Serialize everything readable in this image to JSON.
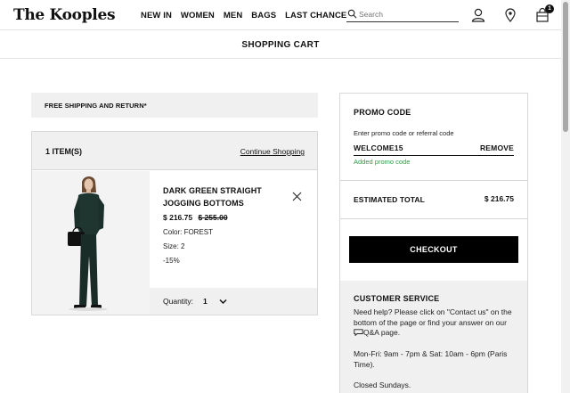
{
  "header": {
    "logo": "The Kooples",
    "nav": [
      "NEW IN",
      "WOMEN",
      "MEN",
      "BAGS",
      "LAST CHANCE"
    ],
    "search_placeholder": "Search",
    "cart_count": "1"
  },
  "page": {
    "title": "SHOPPING CART"
  },
  "shipping_banner": "FREE SHIPPING AND RETURN*",
  "cart": {
    "items_count": "1 ITEM(S)",
    "continue_shopping": "Continue Shopping",
    "item": {
      "name": "DARK GREEN STRAIGHT JOGGING BOTTOMS",
      "price": "$ 216.75",
      "original_price": "$ 255.00",
      "color": "Color: FOREST",
      "size": "Size: 2",
      "discount": "-15%",
      "quantity_label": "Quantity:",
      "quantity": "1"
    }
  },
  "promo": {
    "title": "PROMO CODE",
    "field_label": "Enter promo code or referral code",
    "code": "WELCOME15",
    "remove": "REMOVE",
    "status": "Added promo code"
  },
  "summary": {
    "estimated_label": "ESTIMATED TOTAL",
    "estimated_value": "$ 216.75",
    "checkout": "CHECKOUT"
  },
  "customer_service": {
    "title": "CUSTOMER SERVICE",
    "text_before_icon": "Need help? Please click on \"Contact us\" on the bottom of the page or find your answer on our ",
    "text_after_icon": "Q&A page.",
    "hours": "Mon-Fri: 9am - 7pm & Sat: 10am - 6pm (Paris Time).",
    "closed": "Closed Sundays."
  },
  "colors": {
    "promo_success": "#2e9e44",
    "checkout_bg": "#000000",
    "panel_bg": "#f0f0f0"
  },
  "icons": [
    "search-icon",
    "account-icon",
    "location-pin-icon",
    "cart-icon",
    "close-icon",
    "chevron-down-icon",
    "chat-icon"
  ]
}
